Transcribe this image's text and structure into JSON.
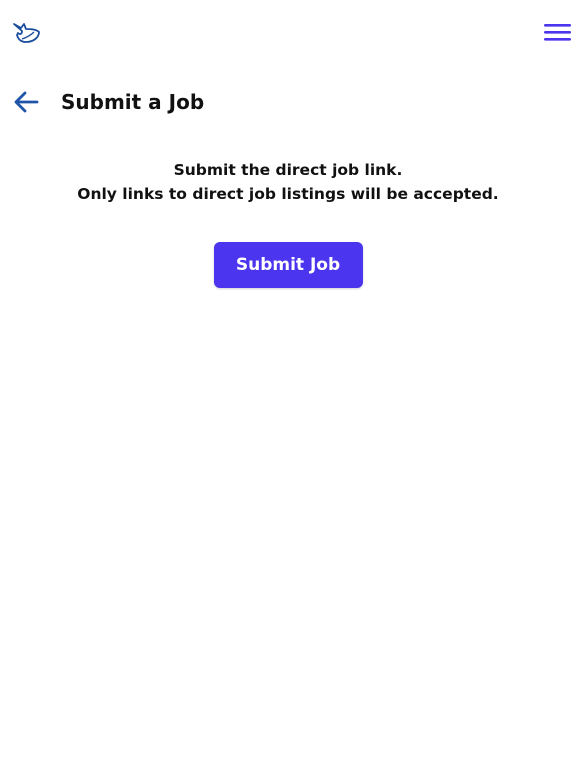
{
  "header": {
    "logo_icon": "whale-logo-icon",
    "menu_icon": "hamburger-menu-icon"
  },
  "page": {
    "back_icon": "arrow-left-icon",
    "title": "Submit a Job"
  },
  "main": {
    "instruction_line1": "Submit the direct job link.",
    "instruction_line2": "Only links to direct job listings will be accepted.",
    "submit_button_label": "Submit Job"
  },
  "colors": {
    "accent": "#4b35ee",
    "logo": "#1a4d9e",
    "back_arrow": "#1f55a8",
    "text": "#111111",
    "background": "#ffffff"
  }
}
